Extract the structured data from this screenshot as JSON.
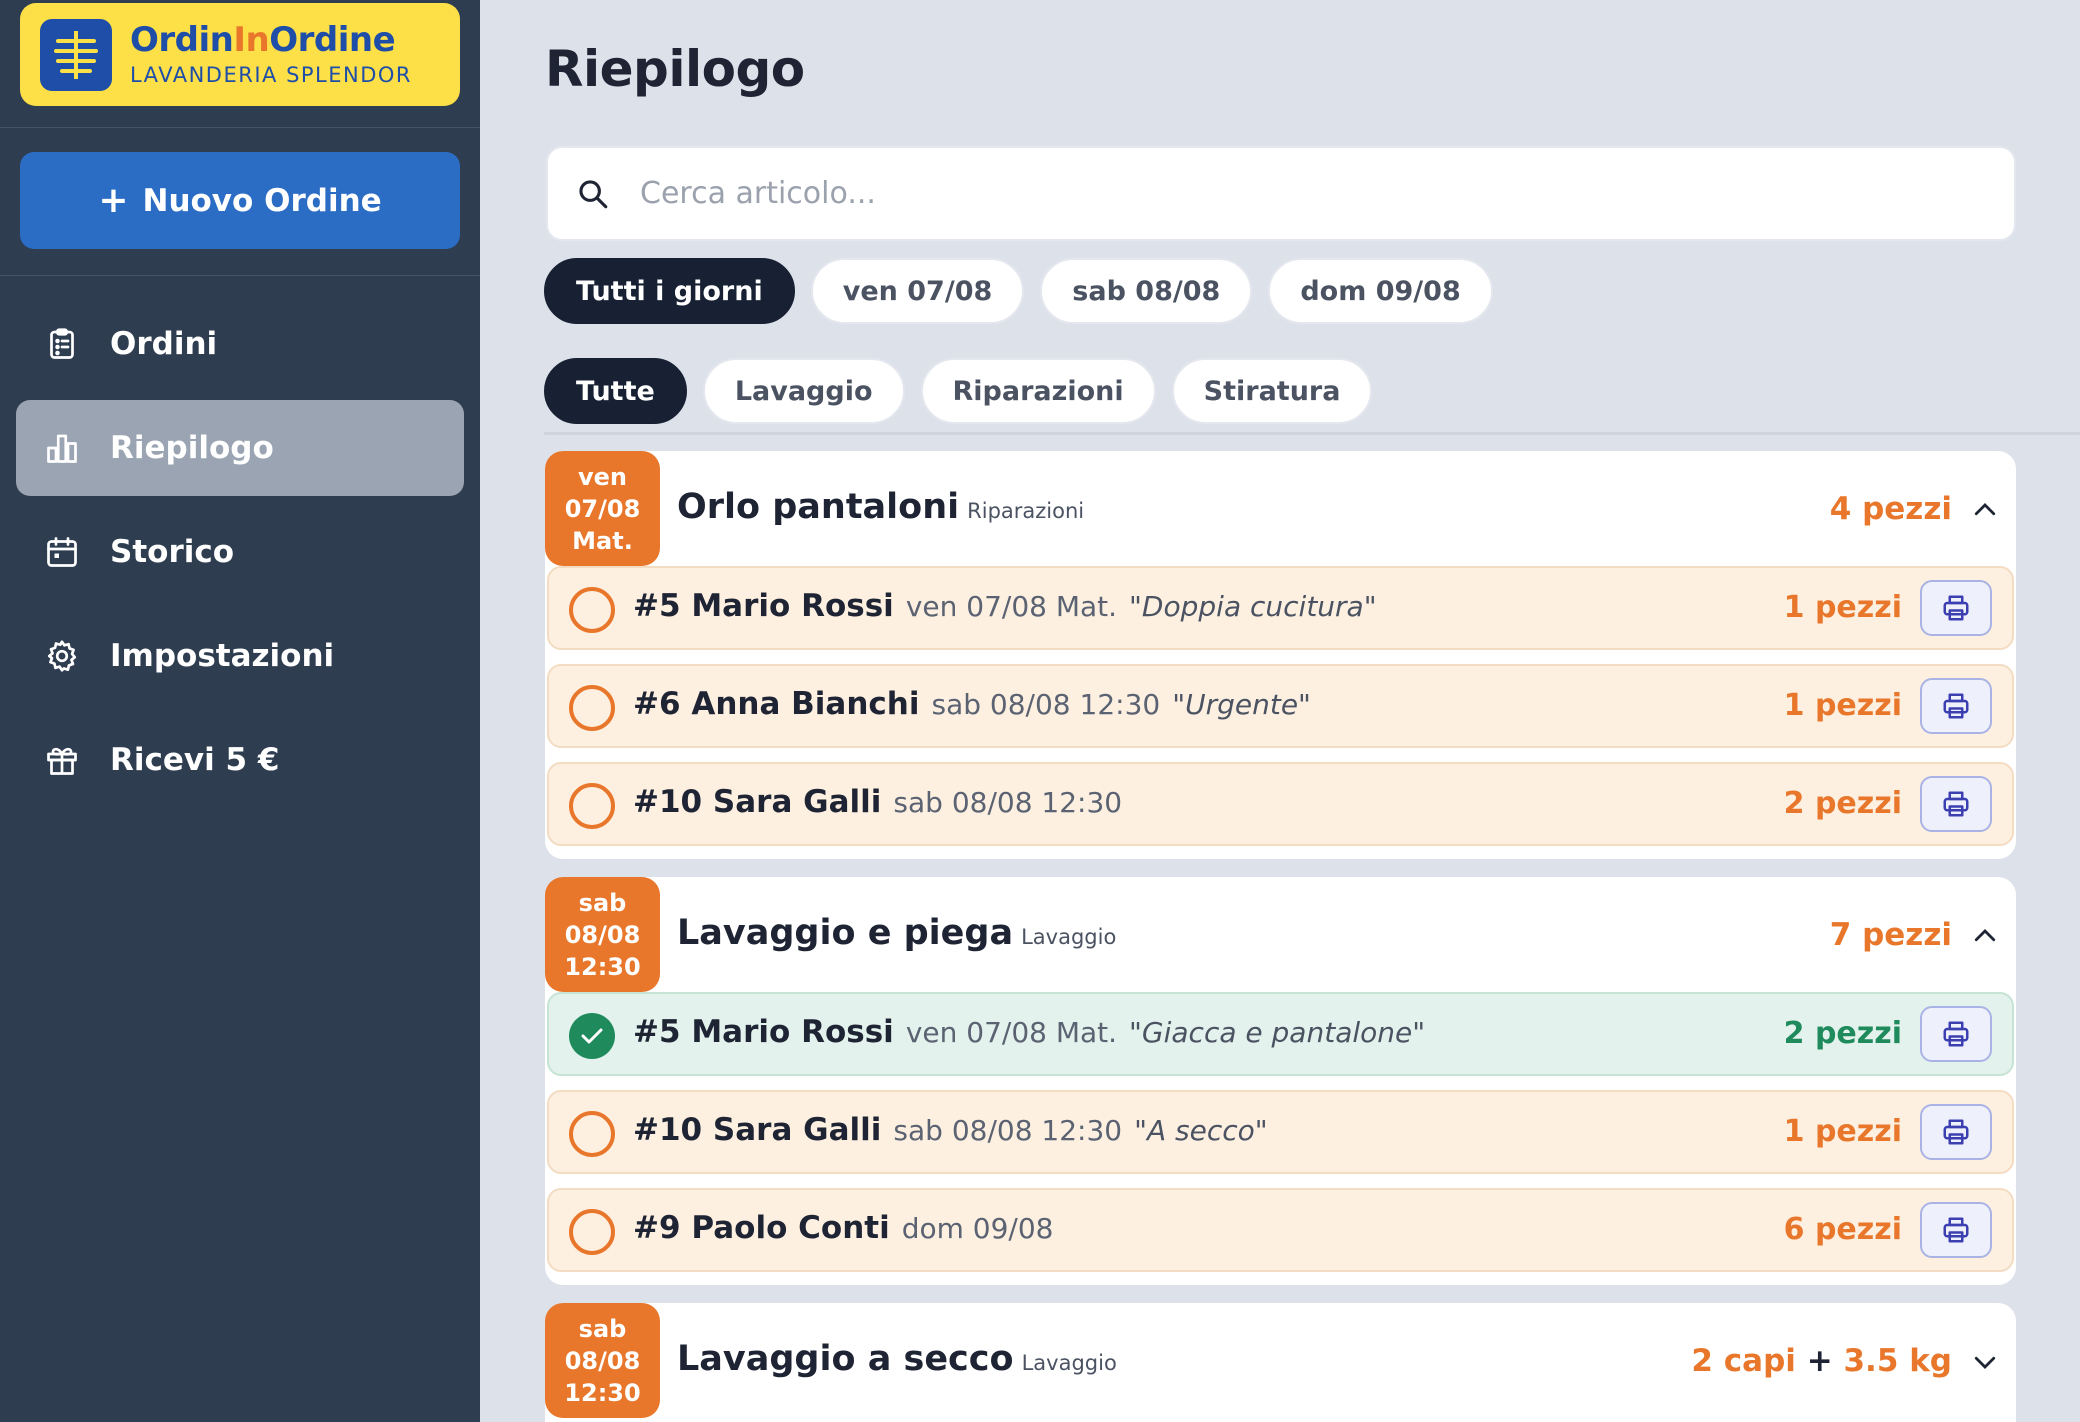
{
  "brand": {
    "title_part1": "Ordin",
    "title_accent": "In",
    "title_part2": "Ordine",
    "subtitle": "LAVANDERIA SPLENDOR"
  },
  "sidebar": {
    "new_order_label": "Nuovo Ordine",
    "items": [
      {
        "label": "Ordini",
        "icon": "clipboard-icon"
      },
      {
        "label": "Riepilogo",
        "icon": "bar-chart-icon",
        "active": true
      },
      {
        "label": "Storico",
        "icon": "calendar-icon"
      },
      {
        "label": "Impostazioni",
        "icon": "gear-icon"
      },
      {
        "label": "Ricevi 5 €",
        "icon": "gift-icon"
      }
    ]
  },
  "main": {
    "title": "Riepilogo",
    "search": {
      "placeholder": "Cerca articolo...",
      "value": ""
    },
    "day_filters": [
      "Tutti i giorni",
      "ven 07/08",
      "sab 08/08",
      "dom 09/08"
    ],
    "day_filter_active": "Tutti i giorni",
    "category_filters": [
      "Tutte",
      "Lavaggio",
      "Riparazioni",
      "Stiratura"
    ],
    "category_filter_active": "Tutte"
  },
  "groups": [
    {
      "badge": [
        "ven",
        "07/08",
        "Mat."
      ],
      "title": "Orlo pantaloni",
      "category": "Riparazioni",
      "total": "4 pezzi",
      "expanded": true,
      "rows": [
        {
          "name": "#5 Mario Rossi",
          "date": "ven 07/08 Mat.",
          "note": "\"Doppia cucitura\"",
          "qty": "1 pezzi",
          "done": false
        },
        {
          "name": "#6 Anna Bianchi",
          "date": "sab 08/08 12:30",
          "note": "\"Urgente\"",
          "qty": "1 pezzi",
          "done": false
        },
        {
          "name": "#10 Sara Galli",
          "date": "sab 08/08 12:30",
          "note": "",
          "qty": "2 pezzi",
          "done": false
        }
      ]
    },
    {
      "badge": [
        "sab",
        "08/08",
        "12:30"
      ],
      "title": "Lavaggio e piega",
      "category": "Lavaggio",
      "total": "7 pezzi",
      "expanded": true,
      "rows": [
        {
          "name": "#5 Mario Rossi",
          "date": "ven 07/08 Mat.",
          "note": "\"Giacca e pantalone\"",
          "qty": "2 pezzi",
          "done": true
        },
        {
          "name": "#10 Sara Galli",
          "date": "sab 08/08 12:30",
          "note": "\"A secco\"",
          "qty": "1 pezzi",
          "done": false
        },
        {
          "name": "#9 Paolo Conti",
          "date": "dom 09/08",
          "note": "",
          "qty": "6 pezzi",
          "done": false
        }
      ]
    },
    {
      "badge": [
        "sab",
        "08/08",
        "12:30"
      ],
      "title": "Lavaggio a secco",
      "category": "Lavaggio",
      "total_a": "2 capi",
      "total_sep": "+",
      "total_b": "3.5 kg",
      "expanded": false,
      "rows": []
    }
  ],
  "colors": {
    "sidebar_bg": "#2e3d50",
    "accent_orange": "#e8772b",
    "primary_blue": "#2b6cc4",
    "done_green": "#1f8a5c",
    "logo_yellow": "#fde047"
  }
}
